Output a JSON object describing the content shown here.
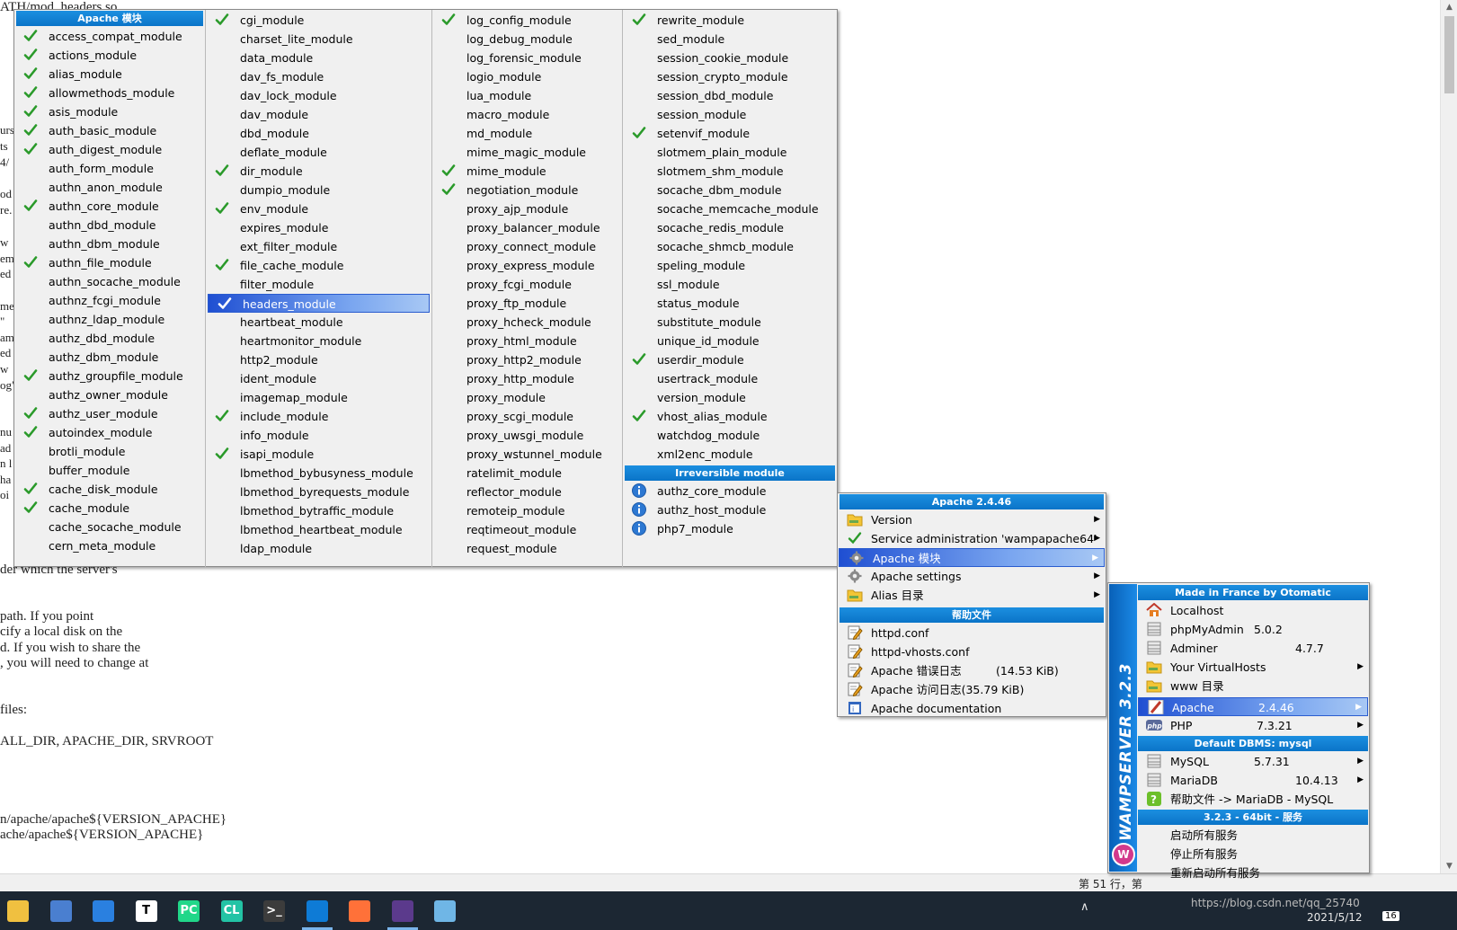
{
  "background_doc": {
    "lines": [
      "ATH/mod_headers.so",
      "der which the server's",
      "path.  If you point",
      "cify a local disk on the",
      "d.  If you wish to share the",
      ", you will need to change at",
      "files:",
      "ALL_DIR, APACHE_DIR, SRVROOT",
      "n/apache/apache${VERSION_APACHE}",
      "ache/apache${VERSION_APACHE}"
    ],
    "left_fragments": [
      "urs",
      "ts",
      "4/",
      "od",
      "re.",
      "w",
      "em",
      "ed",
      "me",
      "\"",
      "am",
      "ed",
      "w",
      "og\"",
      "nu",
      "ad",
      "n l",
      "ha",
      "oi"
    ],
    "status": "第 51 行，第"
  },
  "modules_menu": {
    "header": "Apache 模块",
    "col1": [
      {
        "name": "access_compat_module",
        "checked": true
      },
      {
        "name": "actions_module",
        "checked": true
      },
      {
        "name": "alias_module",
        "checked": true
      },
      {
        "name": "allowmethods_module",
        "checked": true
      },
      {
        "name": "asis_module",
        "checked": true
      },
      {
        "name": "auth_basic_module",
        "checked": true
      },
      {
        "name": "auth_digest_module",
        "checked": true
      },
      {
        "name": "auth_form_module",
        "checked": false
      },
      {
        "name": "authn_anon_module",
        "checked": false
      },
      {
        "name": "authn_core_module",
        "checked": true
      },
      {
        "name": "authn_dbd_module",
        "checked": false
      },
      {
        "name": "authn_dbm_module",
        "checked": false
      },
      {
        "name": "authn_file_module",
        "checked": true
      },
      {
        "name": "authn_socache_module",
        "checked": false
      },
      {
        "name": "authnz_fcgi_module",
        "checked": false
      },
      {
        "name": "authnz_ldap_module",
        "checked": false
      },
      {
        "name": "authz_dbd_module",
        "checked": false
      },
      {
        "name": "authz_dbm_module",
        "checked": false
      },
      {
        "name": "authz_groupfile_module",
        "checked": true
      },
      {
        "name": "authz_owner_module",
        "checked": false
      },
      {
        "name": "authz_user_module",
        "checked": true
      },
      {
        "name": "autoindex_module",
        "checked": true
      },
      {
        "name": "brotli_module",
        "checked": false
      },
      {
        "name": "buffer_module",
        "checked": false
      },
      {
        "name": "cache_disk_module",
        "checked": true
      },
      {
        "name": "cache_module",
        "checked": true
      },
      {
        "name": "cache_socache_module",
        "checked": false
      },
      {
        "name": "cern_meta_module",
        "checked": false
      }
    ],
    "col2": [
      {
        "name": "cgi_module",
        "checked": true
      },
      {
        "name": "charset_lite_module",
        "checked": false
      },
      {
        "name": "data_module",
        "checked": false
      },
      {
        "name": "dav_fs_module",
        "checked": false
      },
      {
        "name": "dav_lock_module",
        "checked": false
      },
      {
        "name": "dav_module",
        "checked": false
      },
      {
        "name": "dbd_module",
        "checked": false
      },
      {
        "name": "deflate_module",
        "checked": false
      },
      {
        "name": "dir_module",
        "checked": true
      },
      {
        "name": "dumpio_module",
        "checked": false
      },
      {
        "name": "env_module",
        "checked": true
      },
      {
        "name": "expires_module",
        "checked": false
      },
      {
        "name": "ext_filter_module",
        "checked": false
      },
      {
        "name": "file_cache_module",
        "checked": true
      },
      {
        "name": "filter_module",
        "checked": false
      },
      {
        "name": "headers_module",
        "checked": true,
        "selected": true
      },
      {
        "name": "heartbeat_module",
        "checked": false
      },
      {
        "name": "heartmonitor_module",
        "checked": false
      },
      {
        "name": "http2_module",
        "checked": false
      },
      {
        "name": "ident_module",
        "checked": false
      },
      {
        "name": "imagemap_module",
        "checked": false
      },
      {
        "name": "include_module",
        "checked": true
      },
      {
        "name": "info_module",
        "checked": false
      },
      {
        "name": "isapi_module",
        "checked": true
      },
      {
        "name": "lbmethod_bybusyness_module",
        "checked": false
      },
      {
        "name": "lbmethod_byrequests_module",
        "checked": false
      },
      {
        "name": "lbmethod_bytraffic_module",
        "checked": false
      },
      {
        "name": "lbmethod_heartbeat_module",
        "checked": false
      },
      {
        "name": "ldap_module",
        "checked": false
      }
    ],
    "col3": [
      {
        "name": "log_config_module",
        "checked": true
      },
      {
        "name": "log_debug_module",
        "checked": false
      },
      {
        "name": "log_forensic_module",
        "checked": false
      },
      {
        "name": "logio_module",
        "checked": false
      },
      {
        "name": "lua_module",
        "checked": false
      },
      {
        "name": "macro_module",
        "checked": false
      },
      {
        "name": "md_module",
        "checked": false
      },
      {
        "name": "mime_magic_module",
        "checked": false
      },
      {
        "name": "mime_module",
        "checked": true
      },
      {
        "name": "negotiation_module",
        "checked": true
      },
      {
        "name": "proxy_ajp_module",
        "checked": false
      },
      {
        "name": "proxy_balancer_module",
        "checked": false
      },
      {
        "name": "proxy_connect_module",
        "checked": false
      },
      {
        "name": "proxy_express_module",
        "checked": false
      },
      {
        "name": "proxy_fcgi_module",
        "checked": false
      },
      {
        "name": "proxy_ftp_module",
        "checked": false
      },
      {
        "name": "proxy_hcheck_module",
        "checked": false
      },
      {
        "name": "proxy_html_module",
        "checked": false
      },
      {
        "name": "proxy_http2_module",
        "checked": false
      },
      {
        "name": "proxy_http_module",
        "checked": false
      },
      {
        "name": "proxy_module",
        "checked": false
      },
      {
        "name": "proxy_scgi_module",
        "checked": false
      },
      {
        "name": "proxy_uwsgi_module",
        "checked": false
      },
      {
        "name": "proxy_wstunnel_module",
        "checked": false
      },
      {
        "name": "ratelimit_module",
        "checked": false
      },
      {
        "name": "reflector_module",
        "checked": false
      },
      {
        "name": "remoteip_module",
        "checked": false
      },
      {
        "name": "reqtimeout_module",
        "checked": false
      },
      {
        "name": "request_module",
        "checked": false
      }
    ],
    "col4": [
      {
        "name": "rewrite_module",
        "checked": true
      },
      {
        "name": "sed_module",
        "checked": false
      },
      {
        "name": "session_cookie_module",
        "checked": false
      },
      {
        "name": "session_crypto_module",
        "checked": false
      },
      {
        "name": "session_dbd_module",
        "checked": false
      },
      {
        "name": "session_module",
        "checked": false
      },
      {
        "name": "setenvif_module",
        "checked": true
      },
      {
        "name": "slotmem_plain_module",
        "checked": false
      },
      {
        "name": "slotmem_shm_module",
        "checked": false
      },
      {
        "name": "socache_dbm_module",
        "checked": false
      },
      {
        "name": "socache_memcache_module",
        "checked": false
      },
      {
        "name": "socache_redis_module",
        "checked": false
      },
      {
        "name": "socache_shmcb_module",
        "checked": false
      },
      {
        "name": "speling_module",
        "checked": false
      },
      {
        "name": "ssl_module",
        "checked": false
      },
      {
        "name": "status_module",
        "checked": false
      },
      {
        "name": "substitute_module",
        "checked": false
      },
      {
        "name": "unique_id_module",
        "checked": false
      },
      {
        "name": "userdir_module",
        "checked": true
      },
      {
        "name": "usertrack_module",
        "checked": false
      },
      {
        "name": "version_module",
        "checked": false
      },
      {
        "name": "vhost_alias_module",
        "checked": true
      },
      {
        "name": "watchdog_module",
        "checked": false
      },
      {
        "name": "xml2enc_module",
        "checked": false
      }
    ],
    "irreversible_header": "Irreversible module",
    "irreversible": [
      "authz_core_module",
      "authz_host_module",
      "php7_module"
    ]
  },
  "apache_menu": {
    "header": "Apache 2.4.46",
    "items": [
      {
        "label": "Version",
        "icon": "folder-icon",
        "submenu": true
      },
      {
        "label": "Service administration 'wampapache64'",
        "icon": "check-icon",
        "submenu": true
      },
      {
        "label": "Apache 模块",
        "icon": "gear-icon",
        "submenu": true,
        "selected": true
      },
      {
        "label": "Apache settings",
        "icon": "gear-icon",
        "submenu": true
      },
      {
        "label": "Alias 目录",
        "icon": "folder-icon",
        "submenu": true
      }
    ],
    "help_header": "帮助文件",
    "help_items": [
      {
        "label": "httpd.conf",
        "icon": "edit-icon"
      },
      {
        "label": "httpd-vhosts.conf",
        "icon": "edit-icon"
      },
      {
        "label": "Apache 错误日志",
        "extra": "(14.53 KiB)",
        "icon": "edit-icon"
      },
      {
        "label": "Apache 访问日志(35.79 KiB)",
        "icon": "edit-icon"
      },
      {
        "label": "Apache documentation",
        "icon": "doc-icon"
      }
    ]
  },
  "wamp_menu": {
    "side_text": "WAMPSERVER 3.2.3",
    "header": "Made in France by Otomatic",
    "items": [
      {
        "label": "Localhost",
        "version": "",
        "icon": "home-icon",
        "submenu": false
      },
      {
        "label": "phpMyAdmin",
        "version": "5.0.2",
        "icon": "db-icon",
        "submenu": false
      },
      {
        "label": "Adminer",
        "version": "4.7.7",
        "icon": "db-icon",
        "submenu": false
      },
      {
        "label": "Your VirtualHosts",
        "version": "",
        "icon": "folder-icon",
        "submenu": true
      },
      {
        "label": "www 目录",
        "version": "",
        "icon": "folder-icon",
        "submenu": false
      }
    ],
    "server_items": [
      {
        "label": "Apache",
        "version": "2.4.46",
        "icon": "apache-icon",
        "submenu": true,
        "selected": true
      },
      {
        "label": "PHP",
        "version": "7.3.21",
        "icon": "php-icon",
        "submenu": true
      }
    ],
    "dbms_header": "Default DBMS: mysql",
    "db_items": [
      {
        "label": "MySQL",
        "version": "5.7.31",
        "icon": "db-icon",
        "submenu": true
      },
      {
        "label": "MariaDB",
        "version": "10.4.13",
        "icon": "db-icon",
        "submenu": true
      },
      {
        "label": "帮助文件 -> MariaDB - MySQL",
        "version": "",
        "icon": "help-icon",
        "submenu": false
      }
    ],
    "service_header": "3.2.3 - 64bit - 服务",
    "service_items": [
      "启动所有服务",
      "停止所有服务",
      "重新启动所有服务"
    ]
  },
  "taskbar": {
    "apps": [
      "file-explorer-icon",
      "network-icon",
      "email-icon",
      "typora-icon",
      "pycharm-icon",
      "clion-icon",
      "terminal-icon",
      "vscode-icon",
      "firefox-icon",
      "eclipse-icon",
      "notepad-icon"
    ],
    "tray_url": "https://blog.csdn.net/qq_25740",
    "date": "2021/5/12",
    "badge": "16"
  },
  "colors": {
    "header_blue": "#0a74c8",
    "check_green": "#2a9a2a",
    "select_blue": "#1f4fd2",
    "taskbar": "#1c2733"
  }
}
